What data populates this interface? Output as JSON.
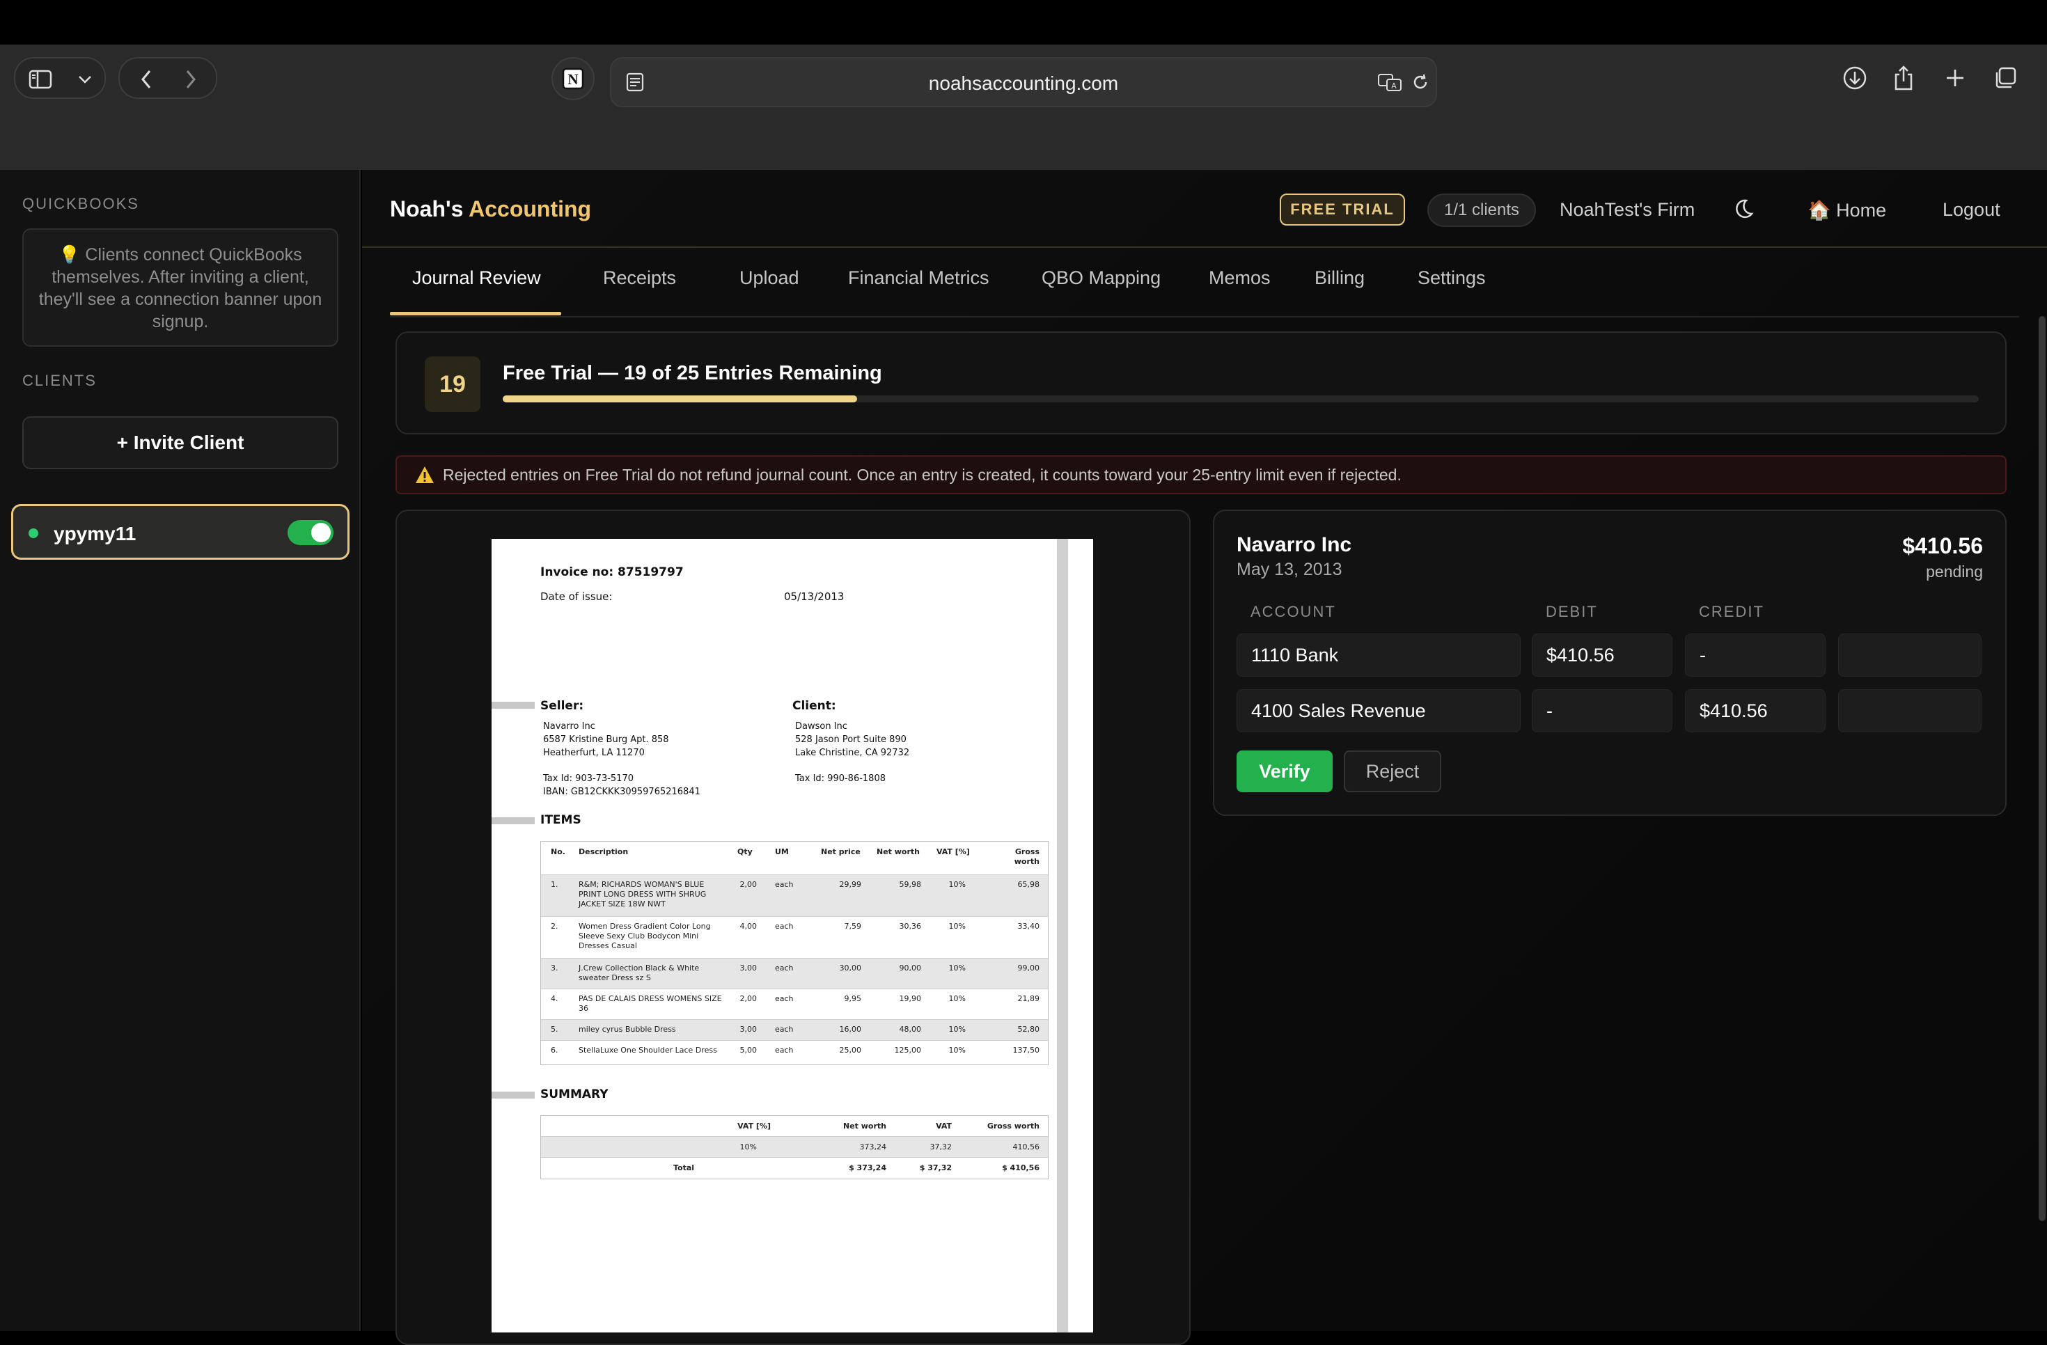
{
  "browser": {
    "url": "noahsaccounting.com"
  },
  "sidebar": {
    "quickbooks_label": "QUICKBOOKS",
    "quickbooks_note": "💡 Clients connect QuickBooks themselves. After inviting a client, they'll see a connection banner upon signup.",
    "clients_label": "CLIENTS",
    "invite_button": "+ Invite Client",
    "client": {
      "name": "ypymy11",
      "enabled": true
    }
  },
  "header": {
    "brand_first": "Noah's",
    "brand_second": "Accounting",
    "trial_badge": "FREE TRIAL",
    "clients_pill": "1/1 clients",
    "firm_name": "NoahTest's Firm",
    "home_label": "🏠 Home",
    "logout_label": "Logout"
  },
  "tabs": [
    "Journal Review",
    "Receipts",
    "Upload",
    "Financial Metrics",
    "QBO Mapping",
    "Memos",
    "Billing",
    "Settings"
  ],
  "active_tab": "Journal Review",
  "trial": {
    "remaining_badge": "19",
    "title": "Free Trial — 19 of 25 Entries Remaining",
    "progress_fraction": 0.24
  },
  "warning": "Rejected entries on Free Trial do not refund journal count. Once an entry is created, it counts toward your 25-entry limit even if rejected.",
  "invoice": {
    "number_label": "Invoice no: 87519797",
    "date_label": "Date of issue:",
    "date_value": "05/13/2013",
    "seller_label": "Seller:",
    "seller_lines": [
      "Navarro Inc",
      "6587 Kristine Burg Apt. 858",
      "Heatherfurt, LA 11270"
    ],
    "seller_tax": "Tax Id: 903-73-5170",
    "seller_iban": "IBAN: GB12CKKK30959765216841",
    "client_label": "Client:",
    "client_lines": [
      "Dawson Inc",
      "528 Jason Port Suite 890",
      "Lake Christine, CA 92732"
    ],
    "client_tax": "Tax Id: 990-86-1808",
    "items_label": "ITEMS",
    "item_headers": [
      "No.",
      "Description",
      "Qty",
      "UM",
      "Net price",
      "Net worth",
      "VAT [%]",
      "Gross worth"
    ],
    "items": [
      {
        "no": "1.",
        "desc": "R&M; RICHARDS WOMAN'S BLUE PRINT LONG DRESS WITH SHRUG JACKET SIZE 18W NWT",
        "qty": "2,00",
        "um": "each",
        "price": "29,99",
        "net": "59,98",
        "vat": "10%",
        "gross": "65,98"
      },
      {
        "no": "2.",
        "desc": "Women Dress Gradient Color Long Sleeve Sexy Club Bodycon Mini Dresses Casual",
        "qty": "4,00",
        "um": "each",
        "price": "7,59",
        "net": "30,36",
        "vat": "10%",
        "gross": "33,40"
      },
      {
        "no": "3.",
        "desc": "J.Crew Collection Black & White sweater Dress sz S",
        "qty": "3,00",
        "um": "each",
        "price": "30,00",
        "net": "90,00",
        "vat": "10%",
        "gross": "99,00"
      },
      {
        "no": "4.",
        "desc": "PAS DE CALAIS DRESS WOMENS SIZE 36",
        "qty": "2,00",
        "um": "each",
        "price": "9,95",
        "net": "19,90",
        "vat": "10%",
        "gross": "21,89"
      },
      {
        "no": "5.",
        "desc": "miley cyrus Bubble Dress",
        "qty": "3,00",
        "um": "each",
        "price": "16,00",
        "net": "48,00",
        "vat": "10%",
        "gross": "52,80"
      },
      {
        "no": "6.",
        "desc": "StellaLuxe One Shoulder Lace Dress",
        "qty": "5,00",
        "um": "each",
        "price": "25,00",
        "net": "125,00",
        "vat": "10%",
        "gross": "137,50"
      }
    ],
    "summary_label": "SUMMARY",
    "summary_headers": [
      "VAT [%]",
      "Net worth",
      "VAT",
      "Gross worth"
    ],
    "summary_row": [
      "10%",
      "373,24",
      "37,32",
      "410,56"
    ],
    "total_row": [
      "Total",
      "$ 373,24",
      "$ 37,32",
      "$ 410,56"
    ]
  },
  "journal": {
    "vendor": "Navarro Inc",
    "date": "May 13, 2013",
    "amount": "$410.56",
    "status": "pending",
    "headers": {
      "account": "ACCOUNT",
      "debit": "DEBIT",
      "credit": "CREDIT"
    },
    "lines": [
      {
        "account": "1110 Bank",
        "debit": "$410.56",
        "credit": "-",
        "extra": ""
      },
      {
        "account": "4100 Sales Revenue",
        "debit": "-",
        "credit": "$410.56",
        "extra": ""
      }
    ],
    "verify_button": "Verify",
    "reject_button": "Reject"
  },
  "colors": {
    "accent_gold": "#e9c77e",
    "verify_green": "#22b14c",
    "status_dot": "#2ecc71"
  }
}
